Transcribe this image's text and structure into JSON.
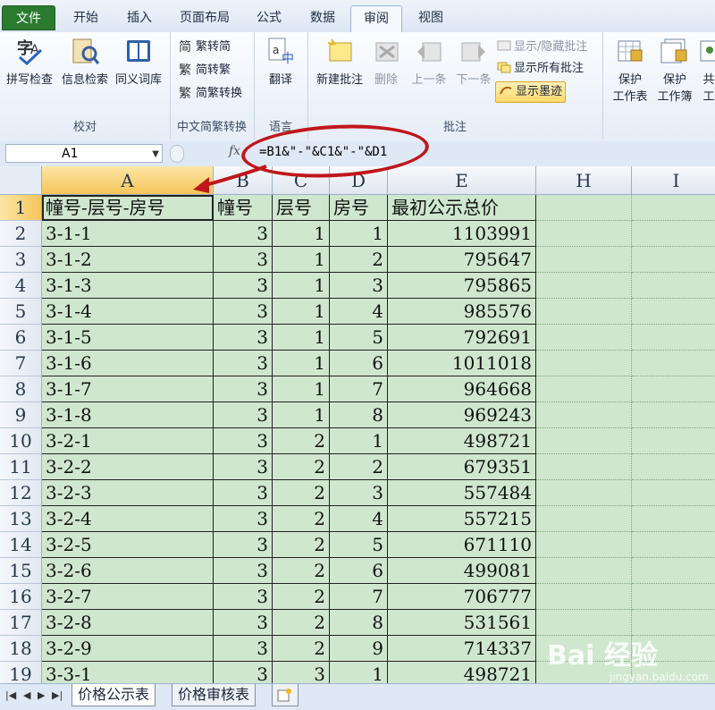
{
  "ribbon_tabs": [
    "文件",
    "开始",
    "插入",
    "页面布局",
    "公式",
    "数据",
    "审阅",
    "视图"
  ],
  "active_tab": "审阅",
  "groups": {
    "proofing": {
      "label": "校对",
      "buttons": [
        "拼写检查",
        "信息检索",
        "同义词库"
      ]
    },
    "chinese": {
      "label": "中文简繁转换",
      "buttons": [
        "繁转简",
        "简转繁",
        "简繁转换"
      ]
    },
    "language": {
      "label": "语言",
      "buttons": [
        "翻译"
      ]
    },
    "comments": {
      "label": "批注",
      "buttons": [
        "新建批注",
        "删除",
        "上一条",
        "下一条"
      ],
      "small": [
        "显示/隐藏批注",
        "显示所有批注",
        "显示墨迹"
      ]
    },
    "protect": {
      "buttons": [
        "保护",
        "工作表",
        "保护",
        "工作簿",
        "共",
        "工"
      ]
    }
  },
  "name_box": "A1",
  "fx_label": "fx",
  "formula": "=B1&\"-\"&C1&\"-\"&D1",
  "columns": [
    "A",
    "B",
    "C",
    "D",
    "E",
    "H",
    "I"
  ],
  "selected_column": "A",
  "rows": [
    [
      "1",
      "幢号-层号-房号",
      "幢号",
      "层号",
      "房号",
      "最初公示总价"
    ],
    [
      "2",
      "3-1-1",
      "3",
      "1",
      "1",
      "1103991"
    ],
    [
      "3",
      "3-1-2",
      "3",
      "1",
      "2",
      "795647"
    ],
    [
      "4",
      "3-1-3",
      "3",
      "1",
      "3",
      "795865"
    ],
    [
      "5",
      "3-1-4",
      "3",
      "1",
      "4",
      "985576"
    ],
    [
      "6",
      "3-1-5",
      "3",
      "1",
      "5",
      "792691"
    ],
    [
      "7",
      "3-1-6",
      "3",
      "1",
      "6",
      "1011018"
    ],
    [
      "8",
      "3-1-7",
      "3",
      "1",
      "7",
      "964668"
    ],
    [
      "9",
      "3-1-8",
      "3",
      "1",
      "8",
      "969243"
    ],
    [
      "10",
      "3-2-1",
      "3",
      "2",
      "1",
      "498721"
    ],
    [
      "11",
      "3-2-2",
      "3",
      "2",
      "2",
      "679351"
    ],
    [
      "12",
      "3-2-3",
      "3",
      "2",
      "3",
      "557484"
    ],
    [
      "13",
      "3-2-4",
      "3",
      "2",
      "4",
      "557215"
    ],
    [
      "14",
      "3-2-5",
      "3",
      "2",
      "5",
      "671110"
    ],
    [
      "15",
      "3-2-6",
      "3",
      "2",
      "6",
      "499081"
    ],
    [
      "16",
      "3-2-7",
      "3",
      "2",
      "7",
      "706777"
    ],
    [
      "17",
      "3-2-8",
      "3",
      "2",
      "8",
      "531561"
    ],
    [
      "18",
      "3-2-9",
      "3",
      "2",
      "9",
      "714337"
    ],
    [
      "19",
      "3-3-1",
      "3",
      "3",
      "1",
      "498721"
    ]
  ],
  "sheet_tabs": [
    "价格公示表",
    "价格审核表"
  ],
  "active_sheet": "价格公示表",
  "watermark": {
    "brand": "Bai 经验",
    "url": "jingyan.baidu.com"
  },
  "colors": {
    "grid_bg": "#cfe7cf",
    "annotation_red": "#c0171b",
    "file_tab": "#2a7a2f",
    "selection_header": "#f5c55a"
  }
}
